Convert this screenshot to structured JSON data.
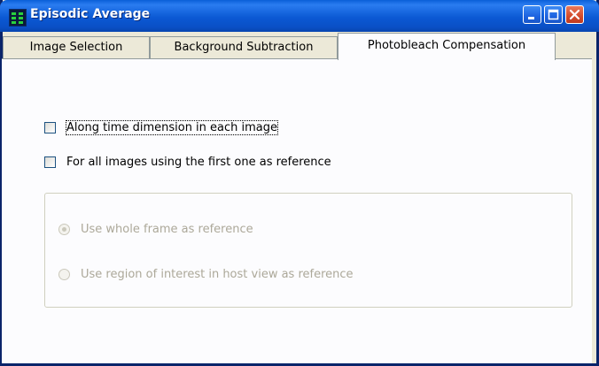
{
  "window": {
    "title": "Episodic Average",
    "icon": "app-grid-icon",
    "controls": {
      "minimize": "minimize-icon",
      "maximize": "maximize-icon",
      "close": "close-icon"
    }
  },
  "tabs": [
    {
      "label": "Image Selection",
      "active": false
    },
    {
      "label": "Background Subtraction",
      "active": false
    },
    {
      "label": "Photobleach Compensation",
      "active": true
    }
  ],
  "options": {
    "along_time": {
      "label": "Along time dimension in each image",
      "checked": false
    },
    "all_images": {
      "label": "For all images using the first one as reference",
      "checked": false
    }
  },
  "reference": {
    "whole_frame": {
      "label": "Use whole frame as reference",
      "selected": true,
      "enabled": false
    },
    "roi": {
      "label": "Use region of interest in host view as reference",
      "selected": false,
      "enabled": false
    }
  }
}
